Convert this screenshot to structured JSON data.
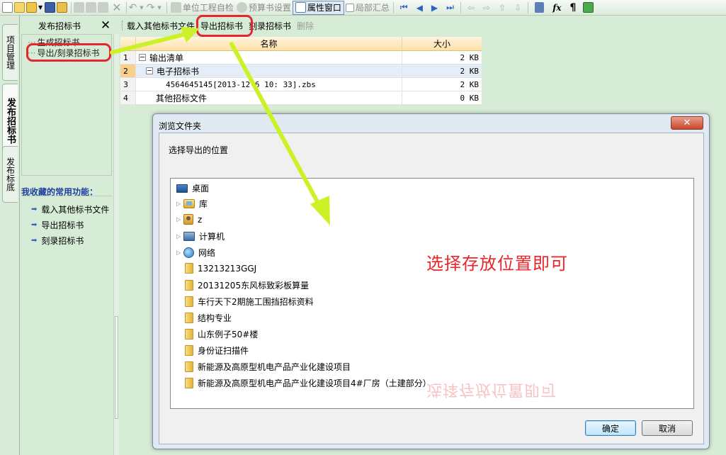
{
  "toolbar": {
    "unit_check": "单位工程自检",
    "budget_settings": "预算书设置",
    "properties_window": "属性窗口",
    "partial_summary": "局部汇总",
    "icons": [
      "new-file-icon",
      "new-project-icon",
      "open-folder-icon",
      "dropdown-icon",
      "save-icon",
      "save-as-icon",
      "cut-icon",
      "copy-icon",
      "paste-icon",
      "delete-icon",
      "undo-icon",
      "redo-icon",
      "first-icon",
      "prev-icon",
      "next-icon",
      "last-icon",
      "move-left-icon",
      "move-right-icon",
      "move-up-icon",
      "move-down-icon",
      "calculator-icon",
      "formula-icon",
      "paragraph-icon",
      "cube-icon"
    ]
  },
  "vtabs": [
    "项目管理",
    "发布招标书",
    "发布标底"
  ],
  "left_panel": {
    "title": "发布招标书",
    "tree": [
      "生成招标书",
      "导出/刻录招标书"
    ],
    "favorites_title": "我收藏的常用功能：",
    "favorites": [
      "载入其他标书文件",
      "导出招标书",
      "刻录招标书"
    ]
  },
  "toolbar2": {
    "load_other": "载入其他标书文件",
    "export": "导出招标书",
    "burn": "刻录招标书",
    "delete": "删除"
  },
  "grid": {
    "headers": [
      "名称",
      "大小"
    ],
    "rows": [
      {
        "num": "1",
        "name": "输出清单",
        "size": "2 KB"
      },
      {
        "num": "2",
        "name": "电子招标书",
        "size": "2 KB"
      },
      {
        "num": "3",
        "name": "4564645145[2013-12-6 10: 33].zbs",
        "size": "2 KB"
      },
      {
        "num": "4",
        "name": "其他招标文件",
        "size": "0 KB"
      }
    ]
  },
  "dialog": {
    "title": "浏览文件夹",
    "prompt": "选择导出的位置",
    "tree": [
      {
        "label": "桌面",
        "icon": "desktop-icon"
      },
      {
        "label": "库",
        "icon": "library-icon"
      },
      {
        "label": "z",
        "icon": "user-folder-icon"
      },
      {
        "label": "计算机",
        "icon": "computer-icon"
      },
      {
        "label": "网络",
        "icon": "network-icon"
      },
      {
        "label": "13213213GGJ",
        "icon": "folder-icon"
      },
      {
        "label": "20131205东风标致彩板算量",
        "icon": "folder-icon"
      },
      {
        "label": "车行天下2期施工围挡招标资料",
        "icon": "folder-icon"
      },
      {
        "label": "结构专业",
        "icon": "folder-icon"
      },
      {
        "label": "山东例子50#楼",
        "icon": "folder-icon"
      },
      {
        "label": "身份证扫描件",
        "icon": "folder-icon"
      },
      {
        "label": "新能源及高原型机电产品产业化建设项目",
        "icon": "folder-icon"
      },
      {
        "label": "新能源及高原型机电产品产业化建设项目4#厂房（土建部分）",
        "icon": "folder-icon"
      }
    ],
    "ok": "确定",
    "cancel": "取消"
  },
  "annotation": {
    "text": "选择存放位置即可",
    "color": "#e8262a",
    "arrow_color": "#ccf227"
  }
}
